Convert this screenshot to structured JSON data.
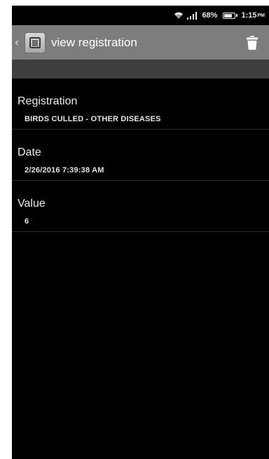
{
  "status_bar": {
    "battery_percent": "68%",
    "time": "1:15",
    "time_suffix": "PM"
  },
  "action_bar": {
    "title": "view registration",
    "back_icon": "chevron-left-icon",
    "app_icon": "document-icon",
    "delete_icon": "trash-icon"
  },
  "fields": [
    {
      "label": "Registration",
      "value": "BIRDS CULLED - OTHER DISEASES"
    },
    {
      "label": "Date",
      "value": "2/26/2016 7:39:38 AM"
    },
    {
      "label": "Value",
      "value": "6"
    }
  ],
  "colors": {
    "action_bar": "#7d7d7d",
    "sub_bar": "#3e3e3e",
    "background": "#000000"
  }
}
